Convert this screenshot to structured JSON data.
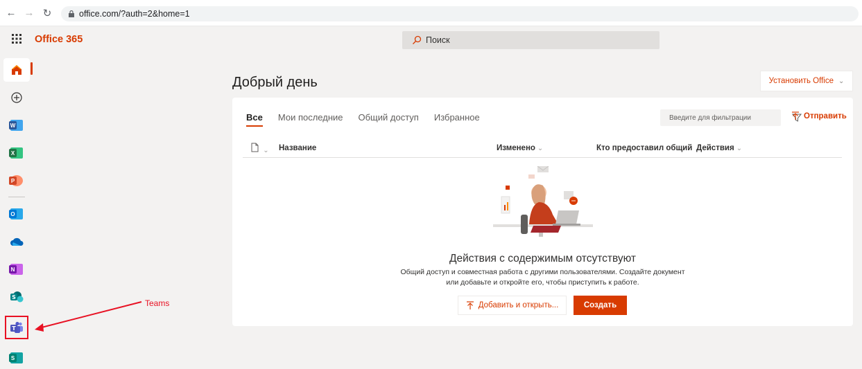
{
  "browser": {
    "url": "office.com/?auth=2&home=1"
  },
  "header": {
    "brand": "Office 365",
    "search_placeholder": "Поиск"
  },
  "rail": {
    "apps": [
      "home",
      "create",
      "word",
      "excel",
      "powerpoint",
      "outlook",
      "onedrive",
      "onenote",
      "sharepoint",
      "teams",
      "sway"
    ]
  },
  "annotation": {
    "label": "Teams",
    "color": "#e81123"
  },
  "main": {
    "greeting": "Добрый день",
    "install_label": "Установить Office",
    "tabs": [
      "Все",
      "Мои последние",
      "Общий доступ",
      "Избранное"
    ],
    "filter_placeholder": "Введите для фильтрации",
    "send_label": "Отправить",
    "columns": {
      "name": "Название",
      "modified": "Изменено",
      "shared_by": "Кто предоставил общий до",
      "actions": "Действия"
    },
    "empty": {
      "title": "Действия с содержимым отсутствуют",
      "line1": "Общий доступ и совместная работа с другими пользователями. Создайте документ",
      "line2": "или добавьте и откройте его, чтобы приступить к работе."
    },
    "upload_label": "Добавить и открыть...",
    "create_label": "Создать"
  },
  "colors": {
    "accent": "#d83b01",
    "word": "#2b579a",
    "excel": "#217346",
    "powerpoint": "#d24726",
    "outlook": "#0078d4",
    "onedrive": "#0364b8",
    "onenote": "#7719aa",
    "sharepoint": "#038387",
    "teams": "#5059c9",
    "sway": "#008272"
  }
}
